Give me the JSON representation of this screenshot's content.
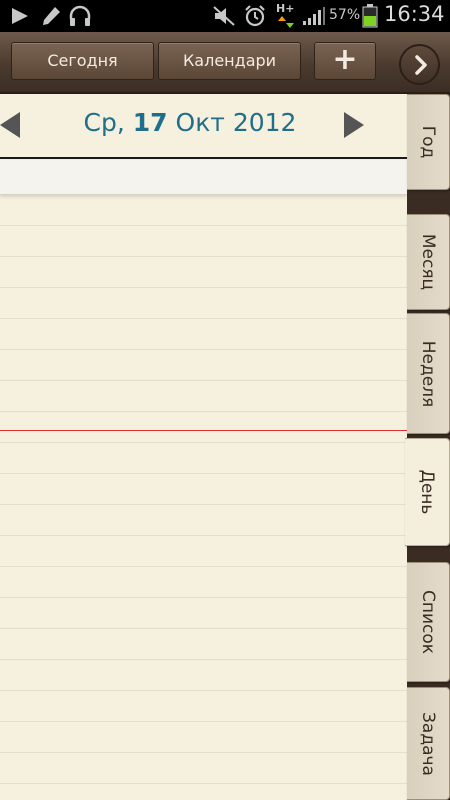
{
  "status_bar": {
    "battery_percent": "57%",
    "time": "16:34",
    "network_label": "H+",
    "icons": [
      "play-icon",
      "pen-icon",
      "headset-icon",
      "mute-icon",
      "alarm-icon",
      "network-h-plus-icon",
      "signal-icon",
      "battery-icon"
    ],
    "battery_color": "#7ed321"
  },
  "toolbar": {
    "today_label": "Сегодня",
    "calendars_label": "Календари",
    "add_label": "+",
    "next_icon": "chevron-right-icon"
  },
  "day_view": {
    "weekday": "Ср,",
    "day": "17",
    "month_year": "Окт 2012",
    "date_color": "#1f6f8b",
    "now_line_color": "#dd3333"
  },
  "tabs": [
    {
      "label": "Год",
      "active": false
    },
    {
      "label": "Месяц",
      "active": false
    },
    {
      "label": "Неделя",
      "active": false
    },
    {
      "label": "День",
      "active": true
    },
    {
      "label": "Список",
      "active": false
    },
    {
      "label": "Задача",
      "active": false
    }
  ]
}
